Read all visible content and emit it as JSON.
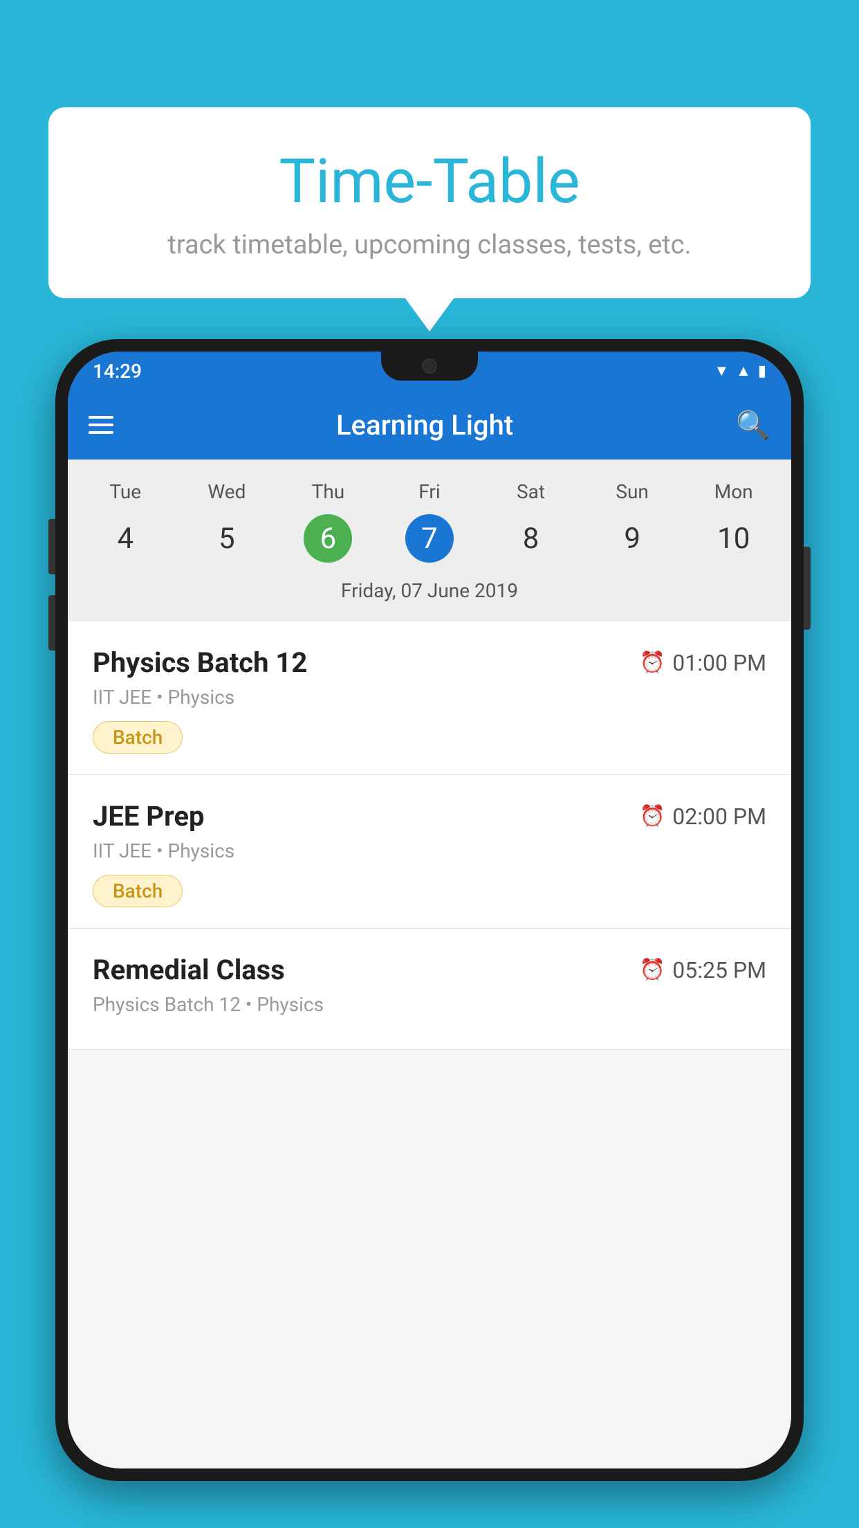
{
  "background_color": "#29b6d8",
  "speech_bubble": {
    "title": "Time-Table",
    "subtitle": "track timetable, upcoming classes, tests, etc."
  },
  "status_bar": {
    "time": "14:29"
  },
  "app_bar": {
    "title": "Learning Light"
  },
  "calendar": {
    "days": [
      "Tue",
      "Wed",
      "Thu",
      "Fri",
      "Sat",
      "Sun",
      "Mon"
    ],
    "dates": [
      "4",
      "5",
      "6",
      "7",
      "8",
      "9",
      "10"
    ],
    "today_index": 2,
    "selected_index": 3,
    "selected_date_label": "Friday, 07 June 2019"
  },
  "schedule": [
    {
      "title": "Physics Batch 12",
      "time": "01:00 PM",
      "subtitle": "IIT JEE • Physics",
      "badge": "Batch"
    },
    {
      "title": "JEE Prep",
      "time": "02:00 PM",
      "subtitle": "IIT JEE • Physics",
      "badge": "Batch"
    },
    {
      "title": "Remedial Class",
      "time": "05:25 PM",
      "subtitle": "Physics Batch 12 • Physics",
      "badge": null
    }
  ]
}
